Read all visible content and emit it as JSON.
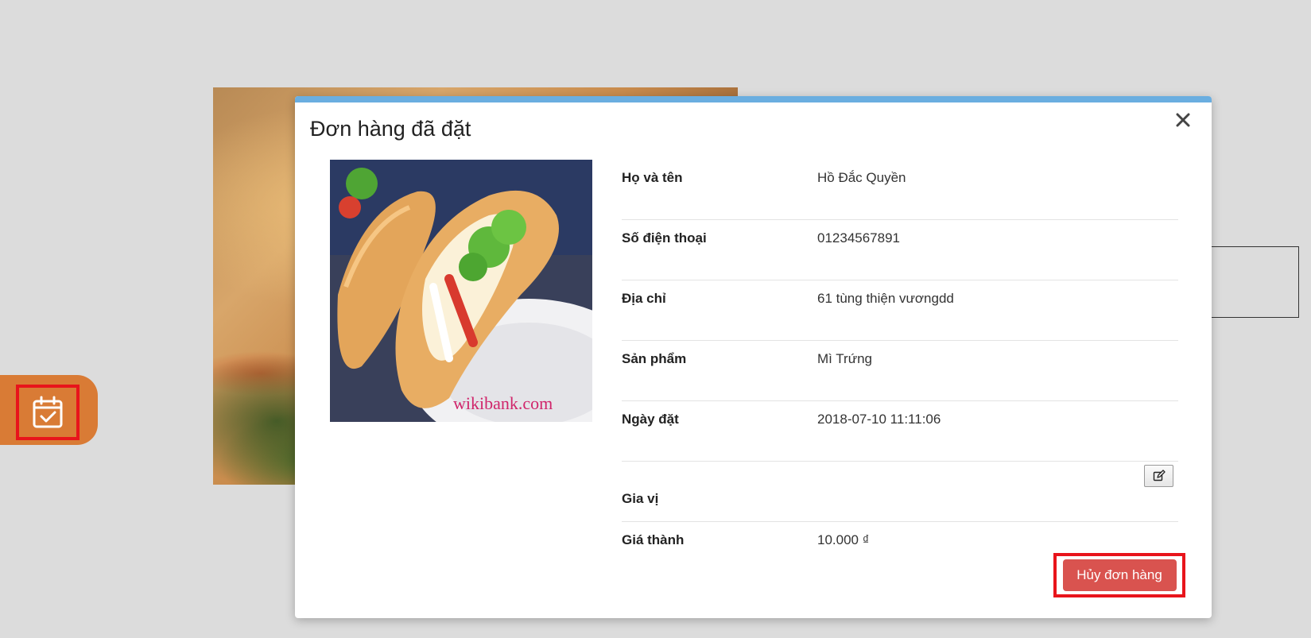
{
  "modal": {
    "title": "Đơn hàng đã đặt",
    "close_icon": "close-icon",
    "fields": [
      {
        "label": "Họ và tên",
        "value": "Hồ Đắc Quyền"
      },
      {
        "label": "Số điện thoại",
        "value": "01234567891"
      },
      {
        "label": "Địa chỉ",
        "value": "61 tùng thiện vươngdd"
      },
      {
        "label": "Sản phẩm",
        "value": "Mì Trứng"
      },
      {
        "label": "Ngày đặt",
        "value": "2018-07-10 11:11:06"
      },
      {
        "label": "Gia vị",
        "value": ""
      },
      {
        "label": "Giá thành",
        "value": "10.000 ₫"
      }
    ],
    "edit_icon": "edit-icon",
    "cancel_label": "Hủy đơn hàng",
    "photo_watermark": "wikibank.com"
  },
  "floating_tab": {
    "icon": "calendar-check-icon"
  },
  "colors": {
    "modal_top_bar": "#6aaee0",
    "cancel_button": "#d9534f",
    "floating_tab": "#d97b35",
    "highlight_border": "#e8141b"
  }
}
